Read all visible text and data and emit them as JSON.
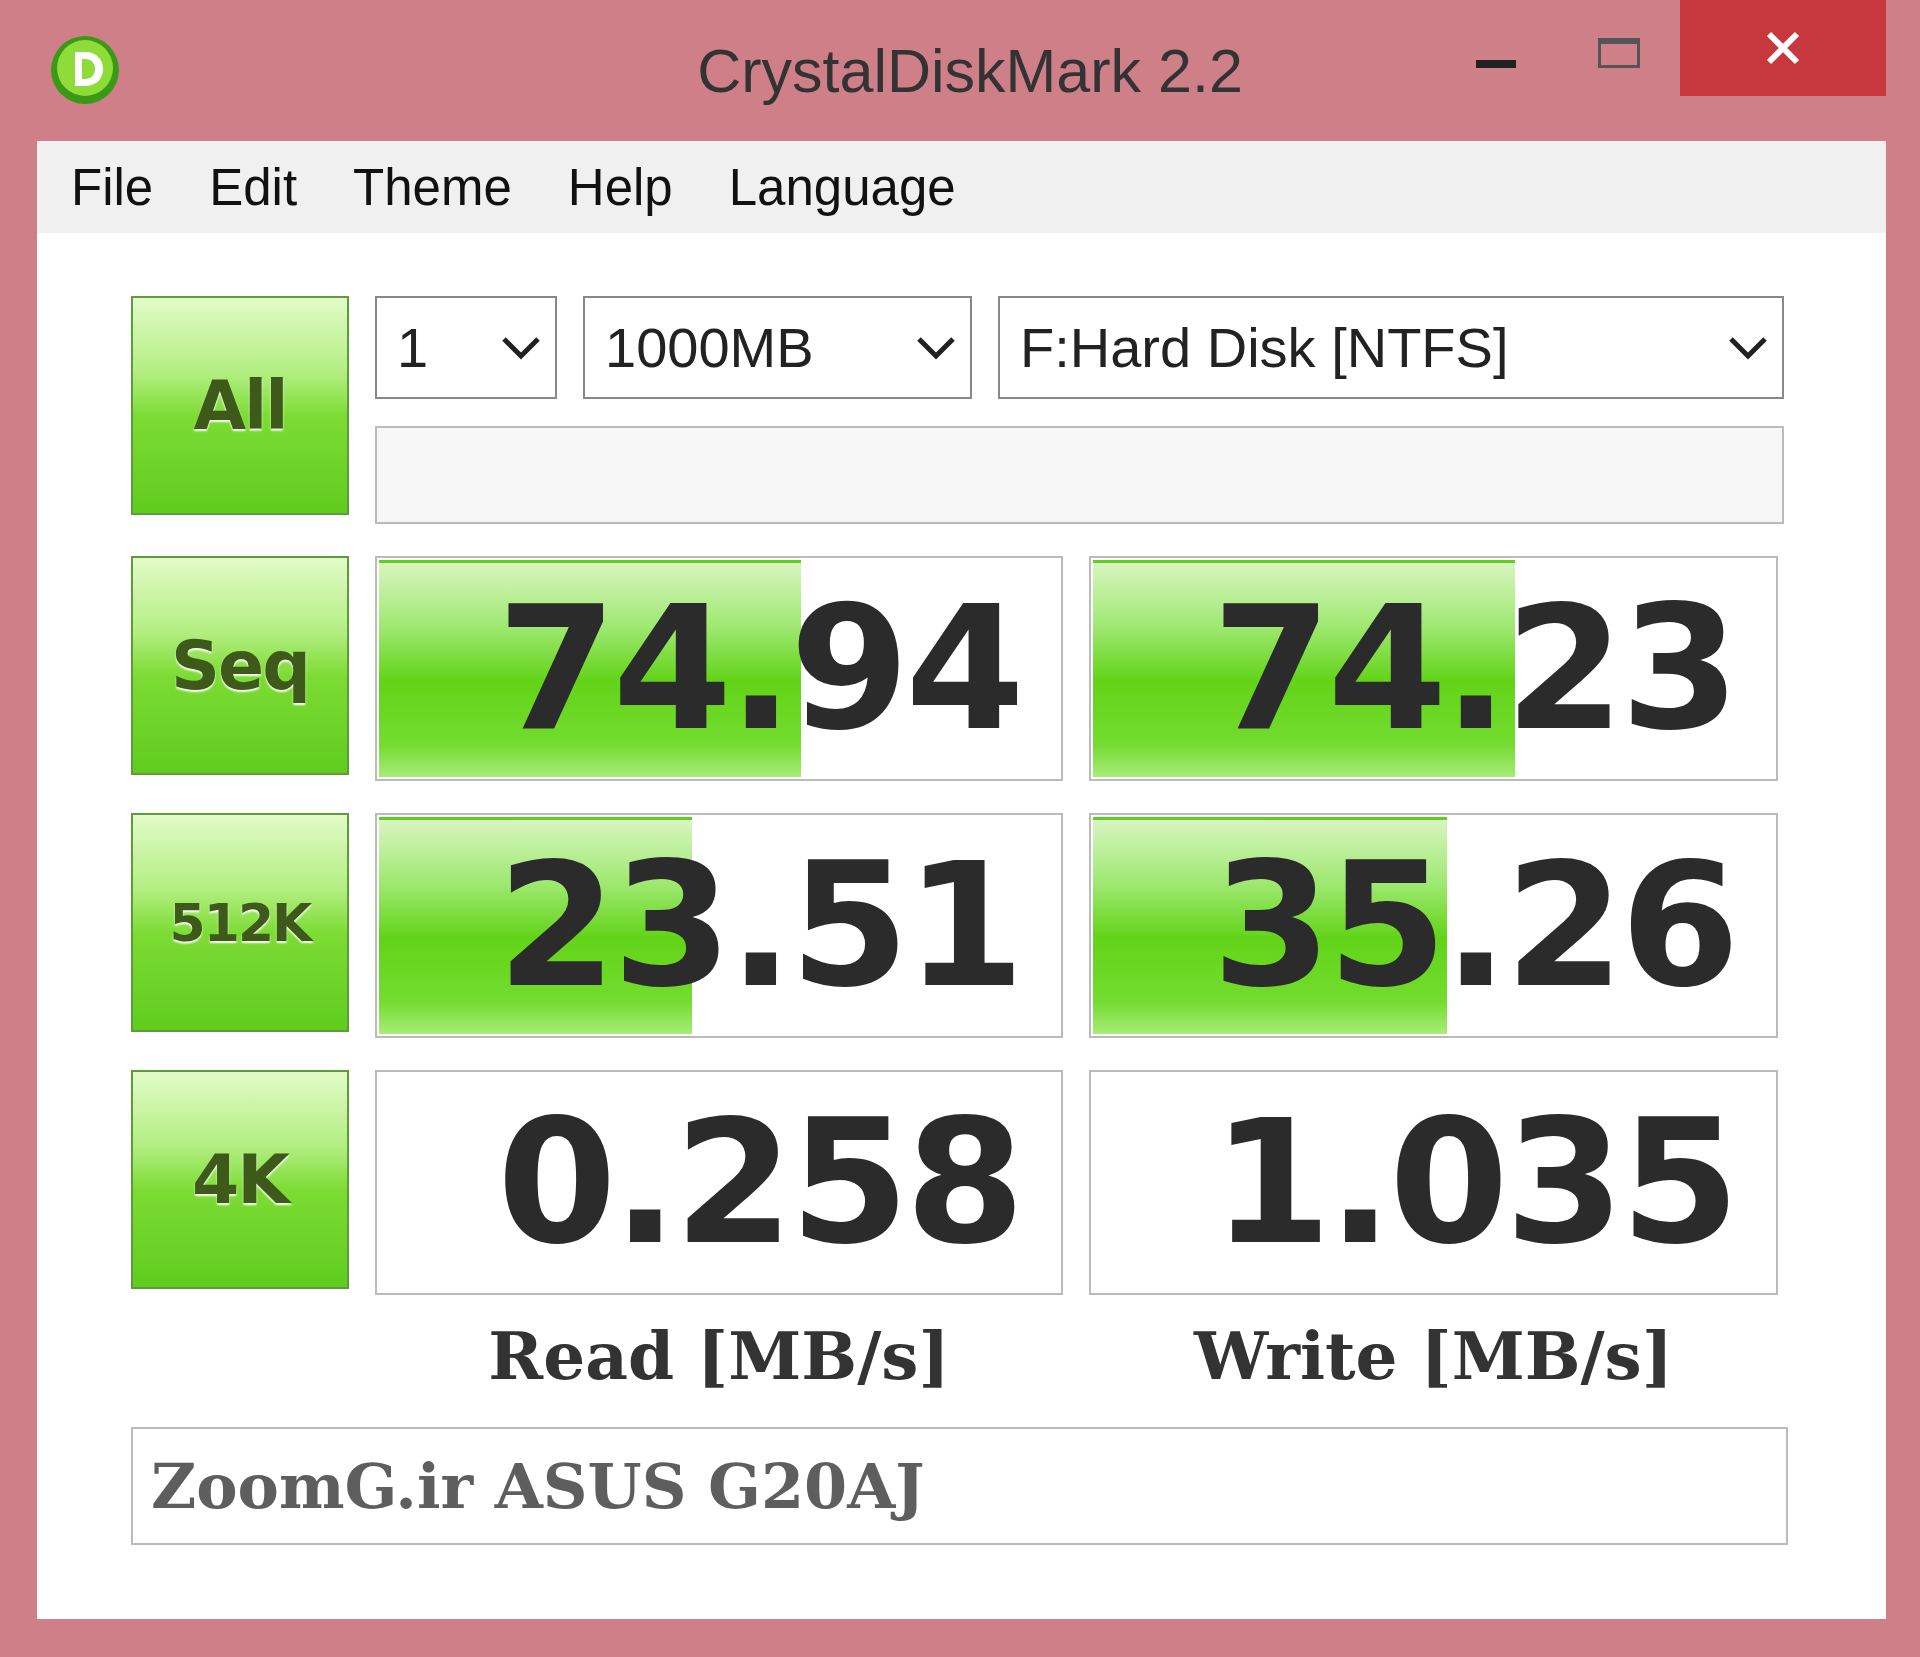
{
  "window": {
    "title": "CrystalDiskMark 2.2"
  },
  "menu": [
    {
      "label": "File"
    },
    {
      "label": "Edit"
    },
    {
      "label": "Theme"
    },
    {
      "label": "Help"
    },
    {
      "label": "Language"
    }
  ],
  "all_button": {
    "label": "All"
  },
  "dropdowns": [
    {
      "value": "1"
    },
    {
      "value": "1000MB"
    },
    {
      "value": "F:Hard Disk [NTFS]"
    }
  ],
  "tests": [
    {
      "label": "Seq",
      "read": {
        "value": "74.94",
        "level": 0.62
      },
      "write": {
        "value": "74.23",
        "level": 0.62
      }
    },
    {
      "label": "512K",
      "read": {
        "value": "23.51",
        "level": 0.46
      },
      "write": {
        "value": "35.26",
        "level": 0.52
      }
    },
    {
      "label": "4K",
      "read": {
        "value": "0.258"
      },
      "write": {
        "value": "1.035"
      }
    }
  ],
  "column_labels": [
    "Read [MB/s]",
    "Write [MB/s]"
  ],
  "comment": {
    "value": "ZoomG.ir ASUS G20AJ"
  }
}
